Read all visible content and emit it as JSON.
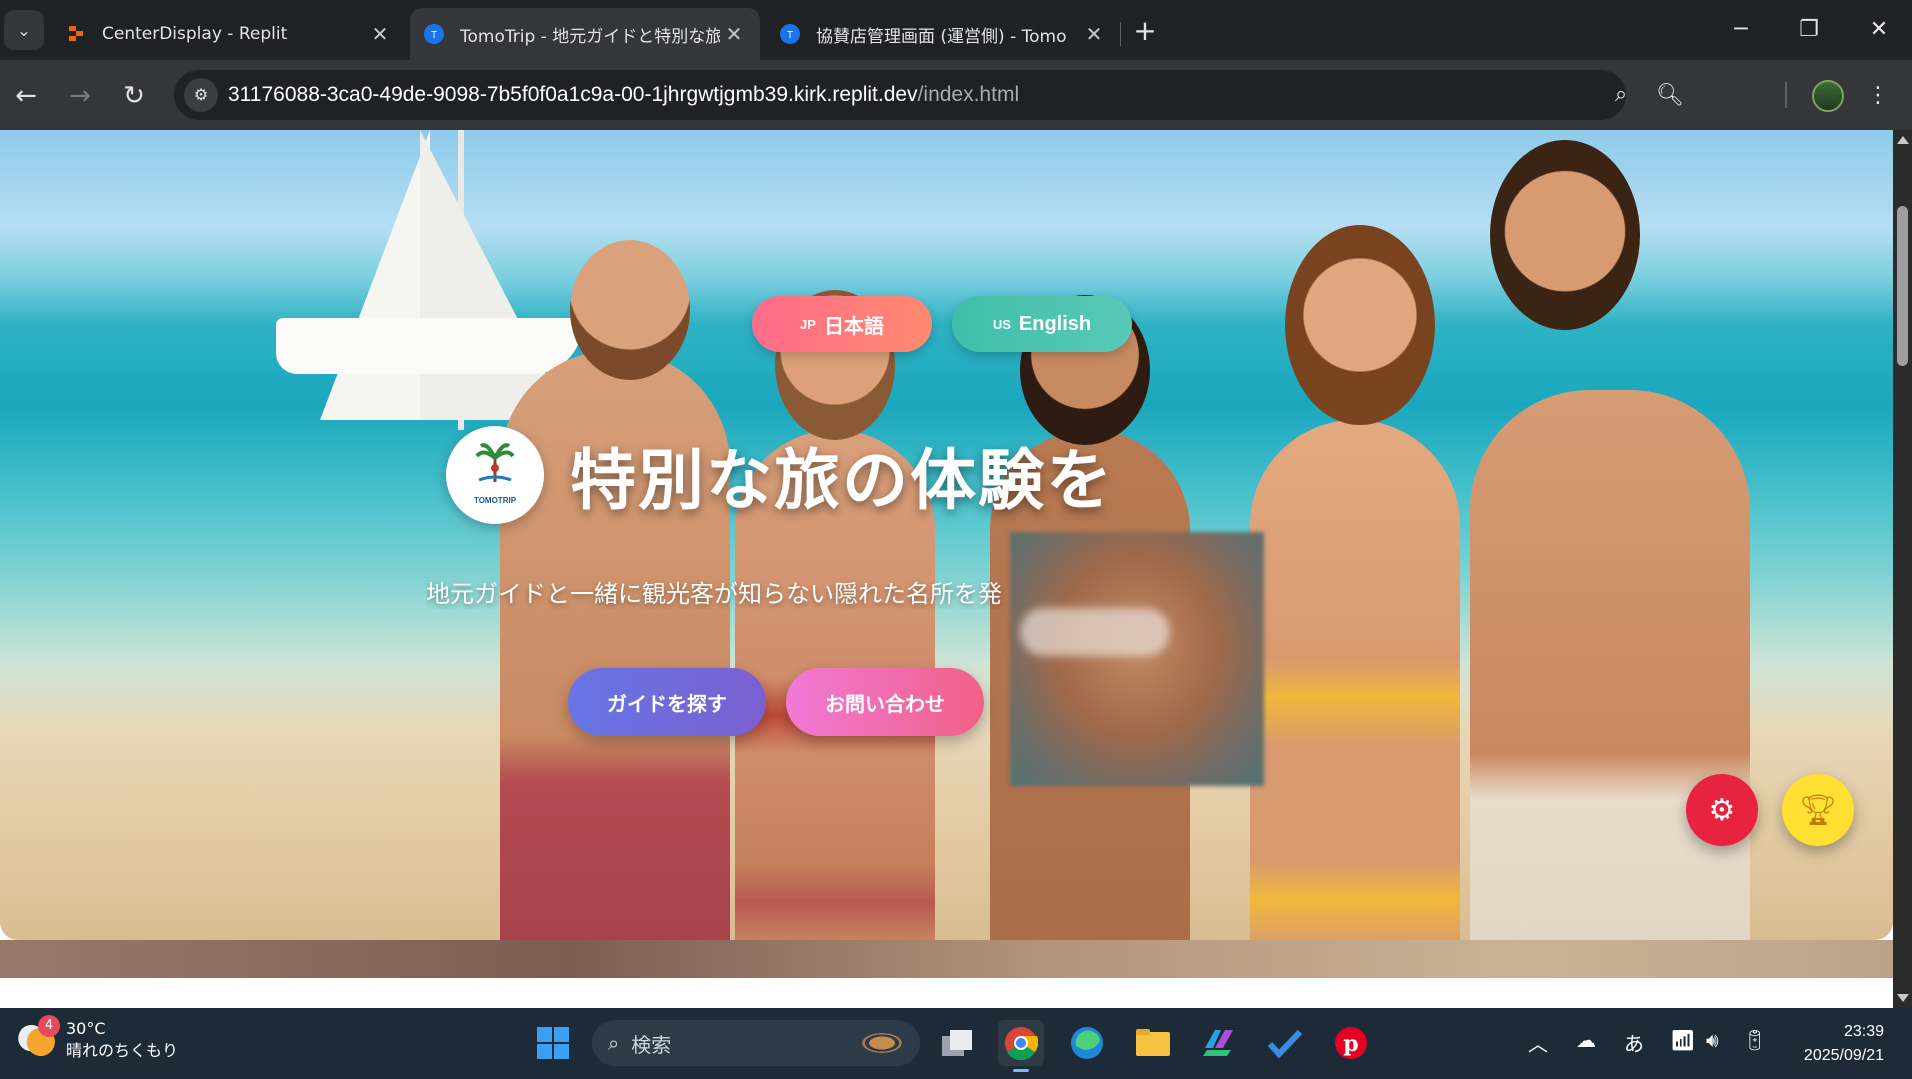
{
  "browser": {
    "tabs": [
      {
        "title": "CenterDisplay - Replit",
        "favicon": "replit-icon",
        "active": false
      },
      {
        "title": "TomoTrip - 地元ガイドと特別な旅",
        "favicon": "tomotrip-icon",
        "active": true
      },
      {
        "title": "協賛店管理画面 (運営側) - Tomo",
        "favicon": "tomotrip-icon",
        "active": false
      }
    ],
    "url_host": "31176088-3ca0-49de-9098-7b5f0f0a1c9a-00-1jhrgwtjgmb39.kirk.replit.dev",
    "url_path": "/index.html"
  },
  "hero": {
    "lang_jp": {
      "flag": "JP",
      "label": "日本語"
    },
    "lang_en": {
      "flag": "US",
      "label": "English"
    },
    "logo_text": "TOMOTRIP",
    "title": "特別な旅の体験を",
    "subtitle": "地元ガイドと一緒に観光客が知らない隠れた名所を発",
    "cta_guide": "ガイドを探す",
    "cta_contact": "お問い合わせ"
  },
  "fabs": {
    "settings_icon": "gear-icon",
    "trophy_icon": "trophy-icon"
  },
  "taskbar": {
    "weather_badge": "4",
    "weather_temp": "30°C",
    "weather_desc": "晴れのちくもり",
    "search_placeholder": "検索",
    "ime": "あ",
    "time": "23:39",
    "date": "2025/09/21"
  },
  "colors": {
    "lang_jp": "#ff6b8a",
    "lang_en": "#3fbfa8",
    "cta_guide": "#6676e6",
    "cta_contact": "#f07ad6",
    "fab_settings": "#e8233f",
    "fab_trophy": "#ffe033"
  }
}
